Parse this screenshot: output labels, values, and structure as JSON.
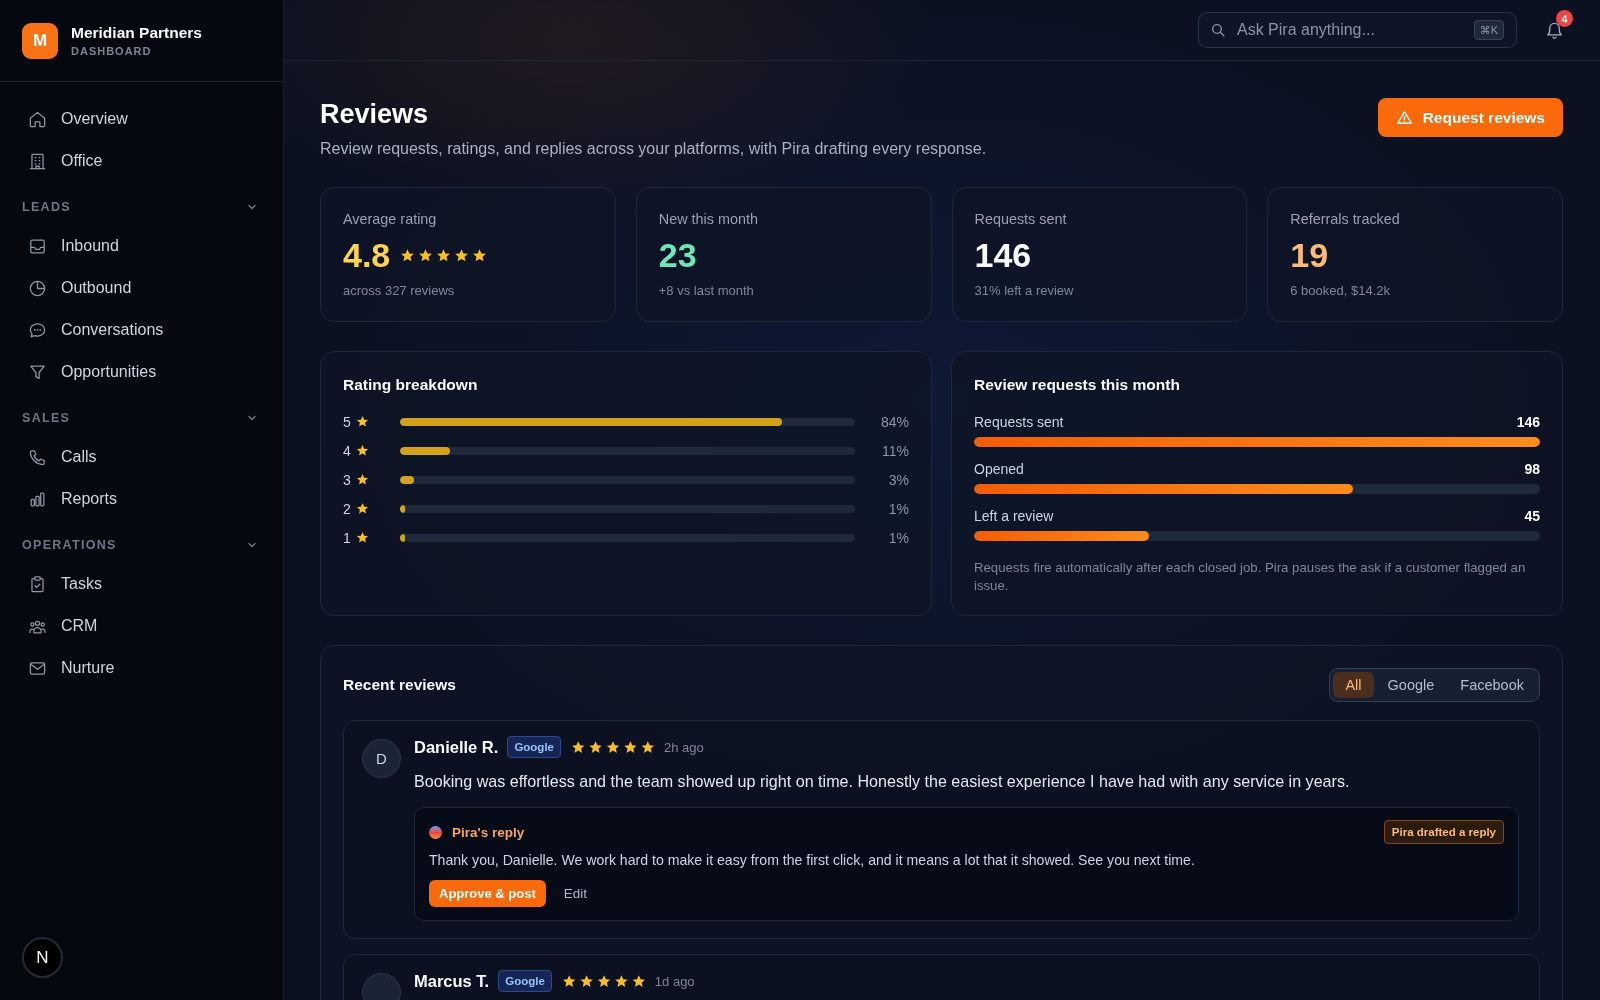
{
  "sidebar": {
    "brand": {
      "logo_letter": "M",
      "name": "Meridian Partners",
      "subtitle": "DASHBOARD"
    },
    "items": [
      {
        "label": "Overview"
      },
      {
        "label": "Office"
      }
    ],
    "sections": [
      {
        "title": "LEADS",
        "expanded": true,
        "items": [
          {
            "label": "Inbound"
          },
          {
            "label": "Outbound"
          },
          {
            "label": "Conversations"
          },
          {
            "label": "Opportunities"
          }
        ]
      },
      {
        "title": "SALES",
        "expanded": true,
        "items": [
          {
            "label": "Calls"
          },
          {
            "label": "Reports"
          }
        ]
      },
      {
        "title": "OPERATIONS",
        "expanded": true,
        "items": [
          {
            "label": "Tasks"
          },
          {
            "label": "CRM"
          },
          {
            "label": "Nurture"
          }
        ]
      }
    ],
    "dev_badge": {
      "letter": "N"
    }
  },
  "topbar": {
    "search": {
      "placeholder": "Ask Pira anything...",
      "shortcut": "⌘K"
    },
    "notifications": {
      "count": "4"
    }
  },
  "page_header": {
    "title": "Reviews",
    "subtitle": "Review requests, ratings, and replies across your platforms, with Pira drafting every response.",
    "action": {
      "label": "Request reviews"
    }
  },
  "stats": [
    {
      "label": "Average rating",
      "value": "4.8",
      "color": "#fcd34d",
      "stars": 5,
      "note": "across 327 reviews"
    },
    {
      "label": "New this month",
      "value": "23",
      "color": "#6ee7b7",
      "note": "+8 vs last month"
    },
    {
      "label": "Requests sent",
      "value": "146",
      "color": "#f8fafc",
      "note": "31% left a review"
    },
    {
      "label": "Referrals tracked",
      "value": "19",
      "color": "#fdba74",
      "note": "6 booked, $14.2k"
    }
  ],
  "rating_breakdown": {
    "title": "Rating breakdown",
    "rows": [
      {
        "rating": "5",
        "level": 0.84,
        "percent": "84%"
      },
      {
        "rating": "4",
        "level": 0.11,
        "percent": "11%"
      },
      {
        "rating": "3",
        "level": 0.03,
        "percent": "3%"
      },
      {
        "rating": "2",
        "level": 0.01,
        "percent": "1%"
      },
      {
        "rating": "1",
        "level": 0.01,
        "percent": "1%"
      }
    ]
  },
  "review_requests": {
    "title": "Review requests this month",
    "rows": [
      {
        "label": "Requests sent",
        "value": "146",
        "level": 1.0
      },
      {
        "label": "Opened",
        "value": "98",
        "level": 0.67
      },
      {
        "label": "Left a review",
        "value": "45",
        "level": 0.31
      }
    ],
    "note": "Requests fire automatically after each closed job. Pira pauses the ask if a customer flagged an issue."
  },
  "recent_reviews": {
    "title": "Recent reviews",
    "filters": [
      {
        "label": "All",
        "selected": true
      },
      {
        "label": "Google",
        "selected": false
      },
      {
        "label": "Facebook",
        "selected": false
      }
    ],
    "reviews": [
      {
        "initial": "D",
        "author": "Danielle R.",
        "platform": "Google",
        "stars": 5,
        "time": "2h ago",
        "text": "Booking was effortless and the team showed up right on time. Honestly the easiest experience I have had with any service in years.",
        "reply": {
          "title": "Pira's reply",
          "status": "Pira drafted a reply",
          "text": "Thank you, Danielle. We work hard to make it easy from the first click, and it means a lot that it showed. See you next time.",
          "approve_label": "Approve & post",
          "edit_label": "Edit"
        }
      },
      {
        "author": "Marcus T.",
        "platform": "Google",
        "stars": 5,
        "time": "1d ago"
      }
    ]
  }
}
